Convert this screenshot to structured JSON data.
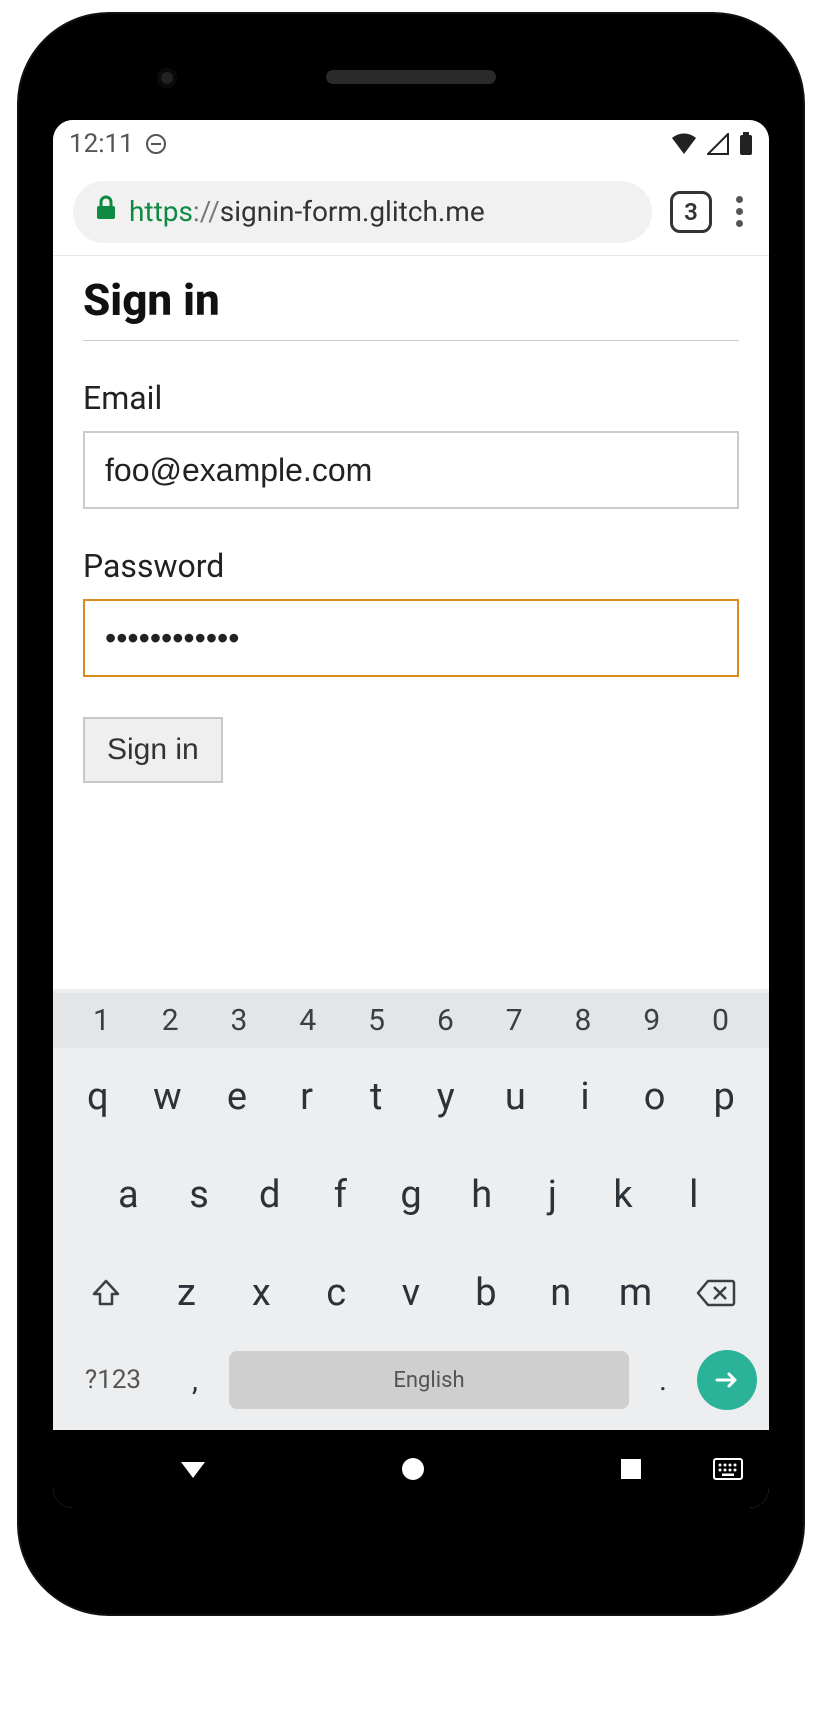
{
  "statusbar": {
    "time": "12:11"
  },
  "browser": {
    "url_scheme": "https",
    "url_sep": "://",
    "url_host": "signin-form.glitch.me",
    "tab_count": "3"
  },
  "page": {
    "title": "Sign in",
    "email_label": "Email",
    "email_value": "foo@example.com",
    "password_label": "Password",
    "password_value": "••••••••••••",
    "submit_label": "Sign in"
  },
  "keyboard": {
    "numbers": [
      "1",
      "2",
      "3",
      "4",
      "5",
      "6",
      "7",
      "8",
      "9",
      "0"
    ],
    "row1": [
      "q",
      "w",
      "e",
      "r",
      "t",
      "y",
      "u",
      "i",
      "o",
      "p"
    ],
    "row2": [
      "a",
      "s",
      "d",
      "f",
      "g",
      "h",
      "j",
      "k",
      "l"
    ],
    "row3": [
      "z",
      "x",
      "c",
      "v",
      "b",
      "n",
      "m"
    ],
    "sym_label": "?123",
    "comma": ",",
    "period": ".",
    "space_label": "English"
  }
}
